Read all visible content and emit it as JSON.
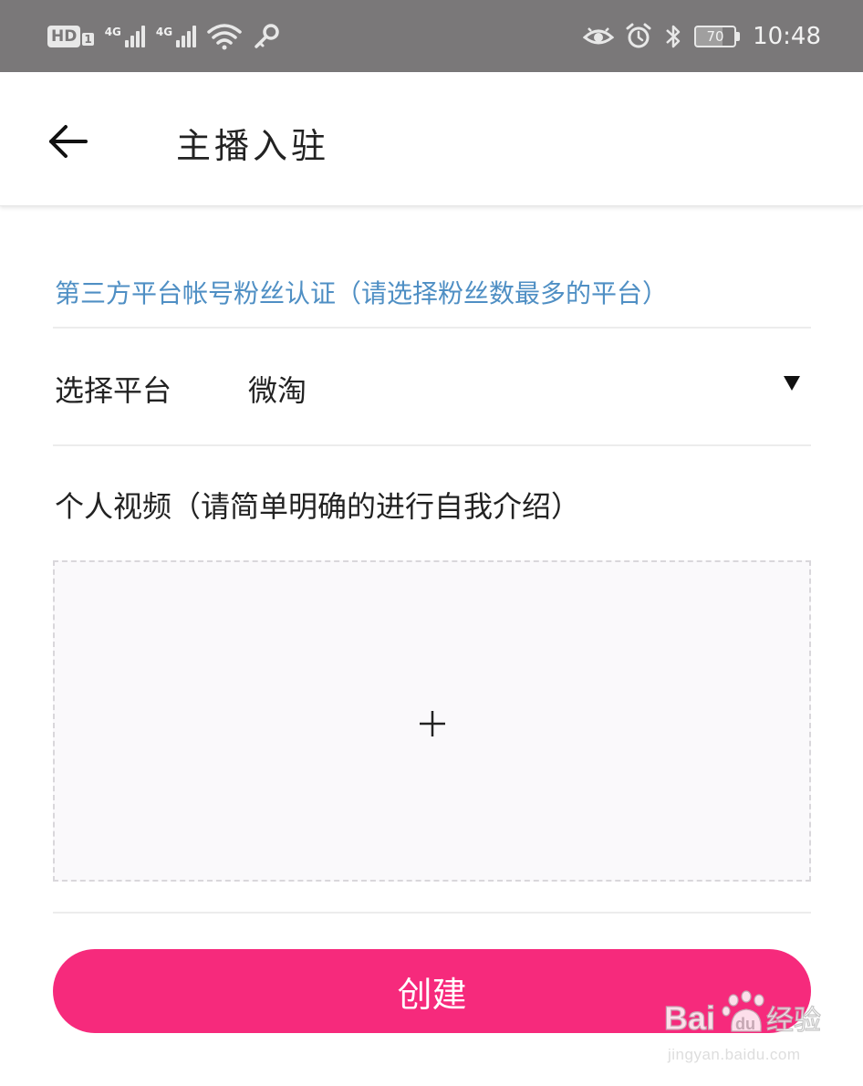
{
  "status_bar": {
    "hd_label": "HD",
    "sim_number": "1",
    "network_1": "4G",
    "network_2": "4G",
    "battery_level": "70",
    "time": "10:48",
    "icons": [
      "hd-icon",
      "signal-icon",
      "signal-icon",
      "wifi-icon",
      "key-icon",
      "eye-icon",
      "alarm-icon",
      "bluetooth-icon",
      "battery-icon"
    ]
  },
  "header": {
    "title": "主播入驻",
    "back_icon": "arrow-left-icon"
  },
  "form": {
    "section_hint": "第三方平台帐号粉丝认证（请选择粉丝数最多的平台）",
    "platform_label": "选择平台",
    "platform_value": "微淘",
    "dropdown_icon": "triangle-down-icon",
    "video_label": "个人视频（请简单明确的进行自我介绍）",
    "upload_icon": "plus-icon"
  },
  "actions": {
    "create_label": "创建"
  },
  "colors": {
    "status_bar_bg": "#7a7879",
    "hint_blue": "#4f8fc4",
    "primary_pink": "#f62a7c",
    "upload_bg": "#faf9fb"
  },
  "watermark": {
    "brand": "Baidu经验",
    "url": "jingyan.baidu.com"
  }
}
